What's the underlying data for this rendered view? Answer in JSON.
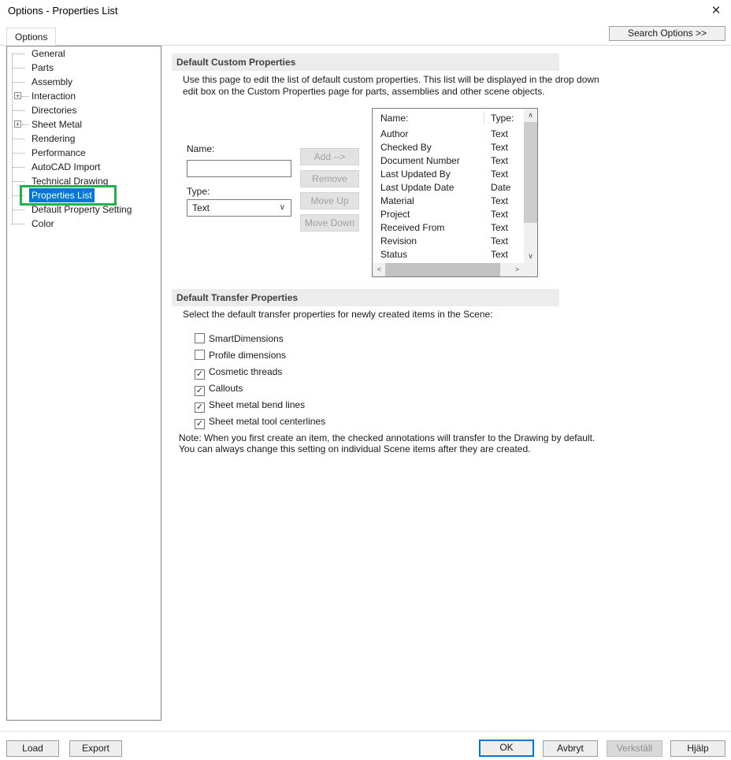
{
  "window": {
    "title": "Options - Properties List"
  },
  "icons": {
    "close": "×",
    "expand": "+",
    "dropdown_chevron": "∨",
    "scroll_up": "∧",
    "scroll_down": "∨",
    "scroll_left": "<",
    "scroll_right": ">"
  },
  "colors": {
    "selection_blue": "#0078d7",
    "annotation_green": "#22b14c",
    "section_header_bg": "#ececec"
  },
  "tabs": {
    "options_label": "Options",
    "search_button": "Search Options >>"
  },
  "tree": {
    "items": [
      {
        "label": "General",
        "expandable": false,
        "selected": false
      },
      {
        "label": "Parts",
        "expandable": false,
        "selected": false
      },
      {
        "label": "Assembly",
        "expandable": false,
        "selected": false
      },
      {
        "label": "Interaction",
        "expandable": true,
        "selected": false
      },
      {
        "label": "Directories",
        "expandable": false,
        "selected": false
      },
      {
        "label": "Sheet Metal",
        "expandable": true,
        "selected": false
      },
      {
        "label": "Rendering",
        "expandable": false,
        "selected": false
      },
      {
        "label": "Performance",
        "expandable": false,
        "selected": false
      },
      {
        "label": "AutoCAD Import",
        "expandable": false,
        "selected": false
      },
      {
        "label": "Technical Drawing",
        "expandable": false,
        "selected": false
      },
      {
        "label": "Properties List",
        "expandable": false,
        "selected": true
      },
      {
        "label": "Default Property Setting",
        "expandable": false,
        "selected": false
      },
      {
        "label": "Color",
        "expandable": false,
        "selected": false
      }
    ]
  },
  "custom_props": {
    "header": "Default Custom Properties",
    "desc_line1": "Use this page to edit the list of default custom properties.  This list will be displayed in the drop down",
    "desc_line2": "edit box on the Custom Properties page for parts, assemblies and other scene objects.",
    "name_label": "Name:",
    "name_value": "",
    "type_label": "Type:",
    "type_value": "Text",
    "buttons": [
      "Add  -->",
      "Remove",
      "Move Up",
      "Move Down"
    ],
    "list": {
      "col_name": "Name:",
      "col_type": "Type:",
      "rows": [
        [
          "Author",
          "Text"
        ],
        [
          "Checked By",
          "Text"
        ],
        [
          "Document Number",
          "Text"
        ],
        [
          "Last Updated By",
          "Text"
        ],
        [
          "Last Update Date",
          "Date"
        ],
        [
          "Material",
          "Text"
        ],
        [
          "Project",
          "Text"
        ],
        [
          "Received From",
          "Text"
        ],
        [
          "Revision",
          "Text"
        ],
        [
          "Status",
          "Text"
        ]
      ]
    }
  },
  "transfer_props": {
    "header": "Default Transfer Properties",
    "desc": "Select the default transfer properties for newly created items in the Scene:",
    "checkboxes": [
      {
        "label": "SmartDimensions",
        "checked": false,
        "glyph": ""
      },
      {
        "label": "Profile dimensions",
        "checked": false,
        "glyph": ""
      },
      {
        "label": "Cosmetic threads",
        "checked": true,
        "glyph": "✓"
      },
      {
        "label": "Callouts",
        "checked": true,
        "glyph": "✓"
      },
      {
        "label": "Sheet metal bend lines",
        "checked": true,
        "glyph": "✓"
      },
      {
        "label": "Sheet metal tool centerlines",
        "checked": true,
        "glyph": "✓"
      }
    ],
    "note_line1": "Note:  When you first create an item, the checked annotations will transfer to the Drawing by default.",
    "note_line2": "You can always change this setting on individual Scene items after they are created."
  },
  "footer": {
    "load": "Load",
    "export": "Export",
    "ok": "OK",
    "cancel": "Avbryt",
    "apply": "Verkställ",
    "help": "Hjälp"
  }
}
